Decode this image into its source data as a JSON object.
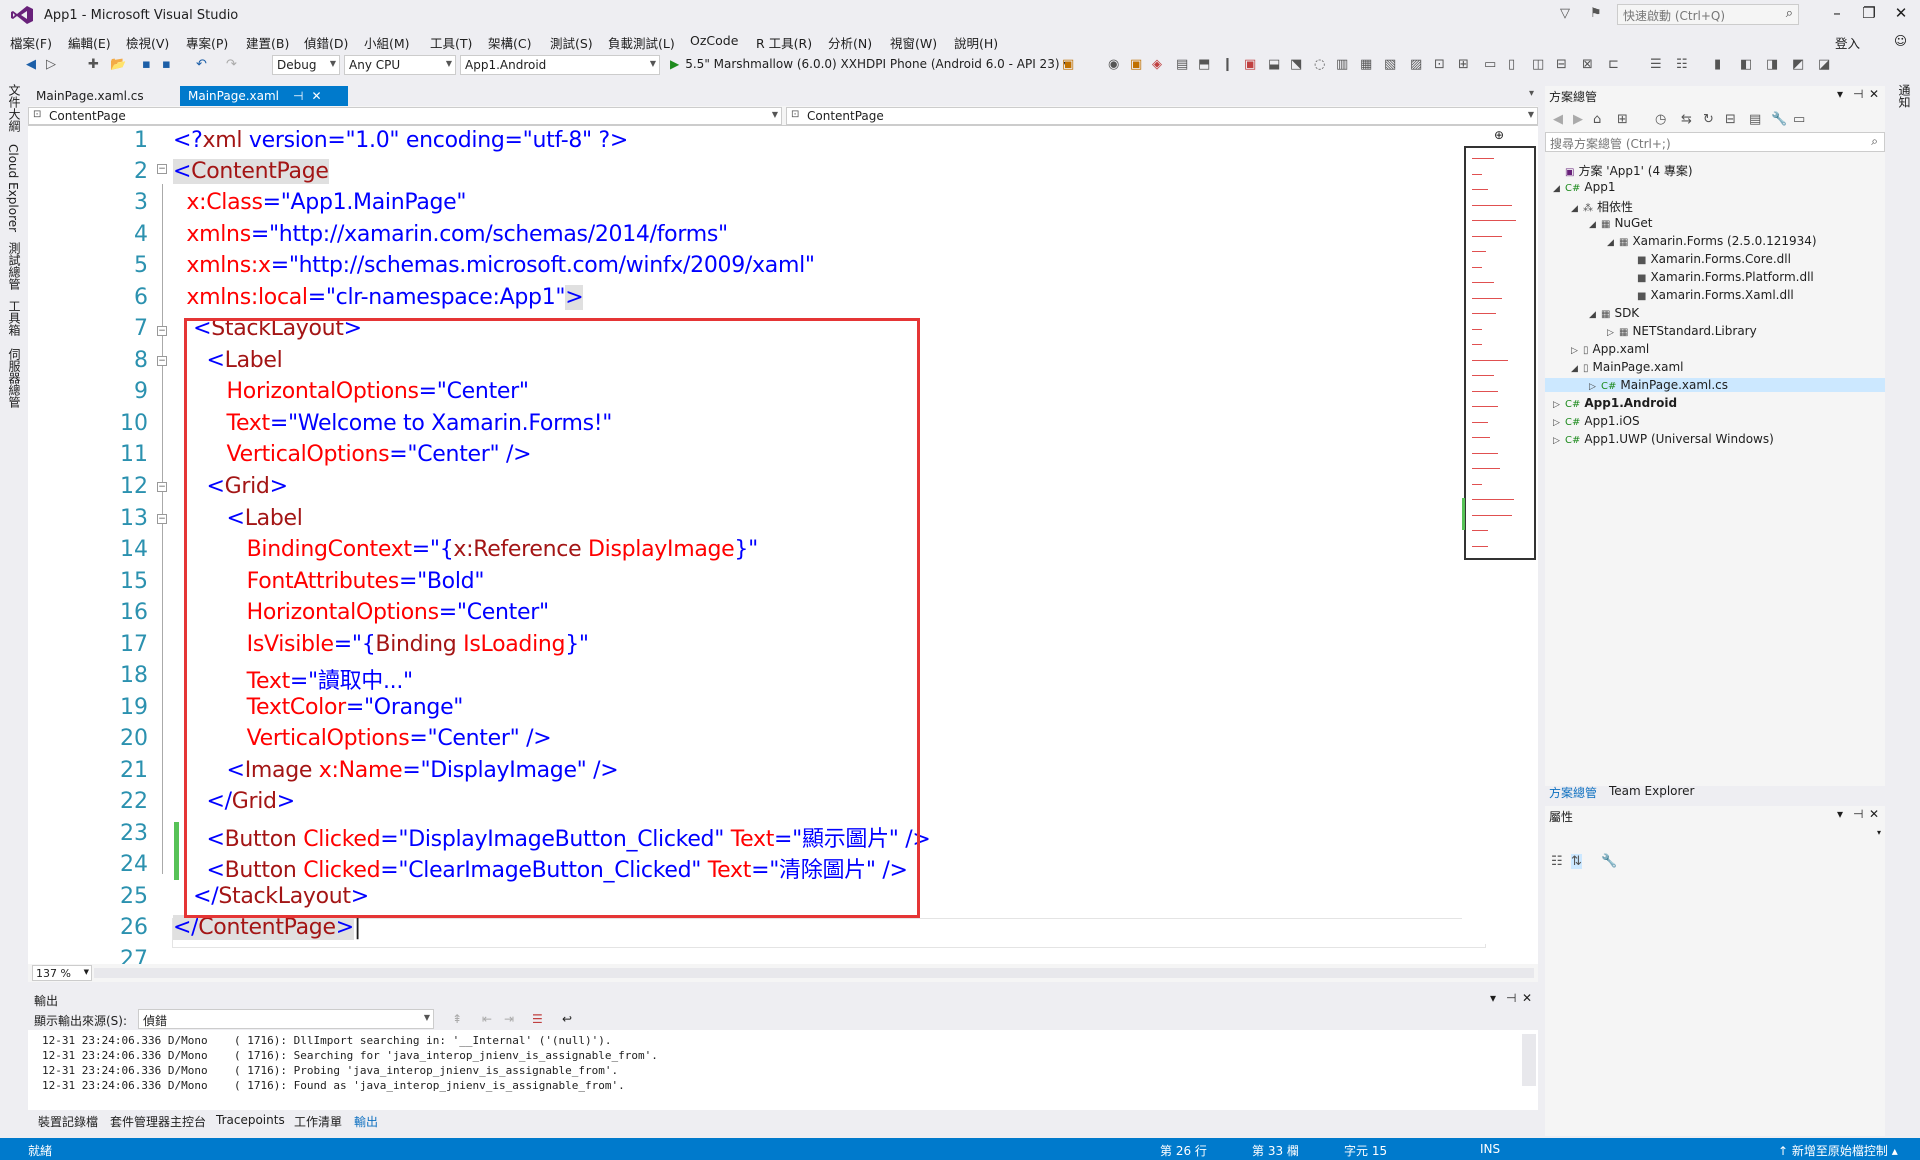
{
  "window": {
    "title": "App1 - Microsoft Visual Studio",
    "quick_launch": "快速啟動 (Ctrl+Q)",
    "sign_in": "登入"
  },
  "menu": [
    "檔案(F)",
    "編輯(E)",
    "檢視(V)",
    "專案(P)",
    "建置(B)",
    "偵錯(D)",
    "小組(M)",
    "工具(T)",
    "架構(C)",
    "測試(S)",
    "負載測試(L)",
    "OzCode",
    "R 工具(R)",
    "分析(N)",
    "視窗(W)",
    "說明(H)"
  ],
  "toolbar": {
    "config": "Debug",
    "platform": "Any CPU",
    "startup_project": "App1.Android",
    "run_target": "5.5\" Marshmallow (6.0.0) XXHDPI Phone (Android 6.0 - API 23)"
  },
  "left_tabs": [
    "文件大綱",
    "Cloud Explorer",
    "測試總管",
    "工具箱",
    "伺服器總管"
  ],
  "doc_tabs": [
    {
      "label": "MainPage.xaml.cs"
    },
    {
      "label": "MainPage.xaml"
    }
  ],
  "nav": {
    "left": "ContentPage",
    "right": "ContentPage"
  },
  "editor": {
    "line_numbers": [
      "1",
      "2",
      "3",
      "4",
      "5",
      "6",
      "7",
      "8",
      "9",
      "10",
      "11",
      "12",
      "13",
      "14",
      "15",
      "16",
      "17",
      "18",
      "19",
      "20",
      "21",
      "22",
      "23",
      "24",
      "25",
      "26",
      "27"
    ],
    "zoom": "137 %"
  },
  "output": {
    "title": "輸出",
    "source_label": "顯示輸出來源(S):",
    "source_value": "偵錯",
    "lines": [
      "12-31 23:24:06.336 D/Mono    ( 1716): DllImport searching in: '__Internal' ('(null)').",
      "12-31 23:24:06.336 D/Mono    ( 1716): Searching for 'java_interop_jnienv_is_assignable_from'.",
      "12-31 23:24:06.336 D/Mono    ( 1716): Probing 'java_interop_jnienv_is_assignable_from'.",
      "12-31 23:24:06.336 D/Mono    ( 1716): Found as 'java_interop_jnienv_is_assignable_from'."
    ]
  },
  "bottom_tabs": [
    "裝置記錄檔",
    "套件管理器主控台",
    "Tracepoints",
    "工作清單",
    "輸出"
  ],
  "status": {
    "ready": "就緒",
    "line": "第 26 行",
    "col": "第 33 欄",
    "ch": "字元 15",
    "ins": "INS",
    "source_control": "新增至原始檔控制"
  },
  "solution": {
    "title": "方案總管",
    "search": "搜尋方案總管 (Ctrl+;)",
    "tree": [
      "方案 'App1' (4 專案)",
      "App1",
      "相依性",
      "NuGet",
      "Xamarin.Forms (2.5.0.121934)",
      "Xamarin.Forms.Core.dll",
      "Xamarin.Forms.Platform.dll",
      "Xamarin.Forms.Xaml.dll",
      "SDK",
      "NETStandard.Library",
      "App.xaml",
      "MainPage.xaml",
      "MainPage.xaml.cs",
      "App1.Android",
      "App1.iOS",
      "App1.UWP (Universal Windows)"
    ],
    "tabs": [
      "方案總管",
      "Team Explorer"
    ]
  },
  "properties": {
    "title": "屬性"
  },
  "right_tabs": [
    "通知"
  ]
}
